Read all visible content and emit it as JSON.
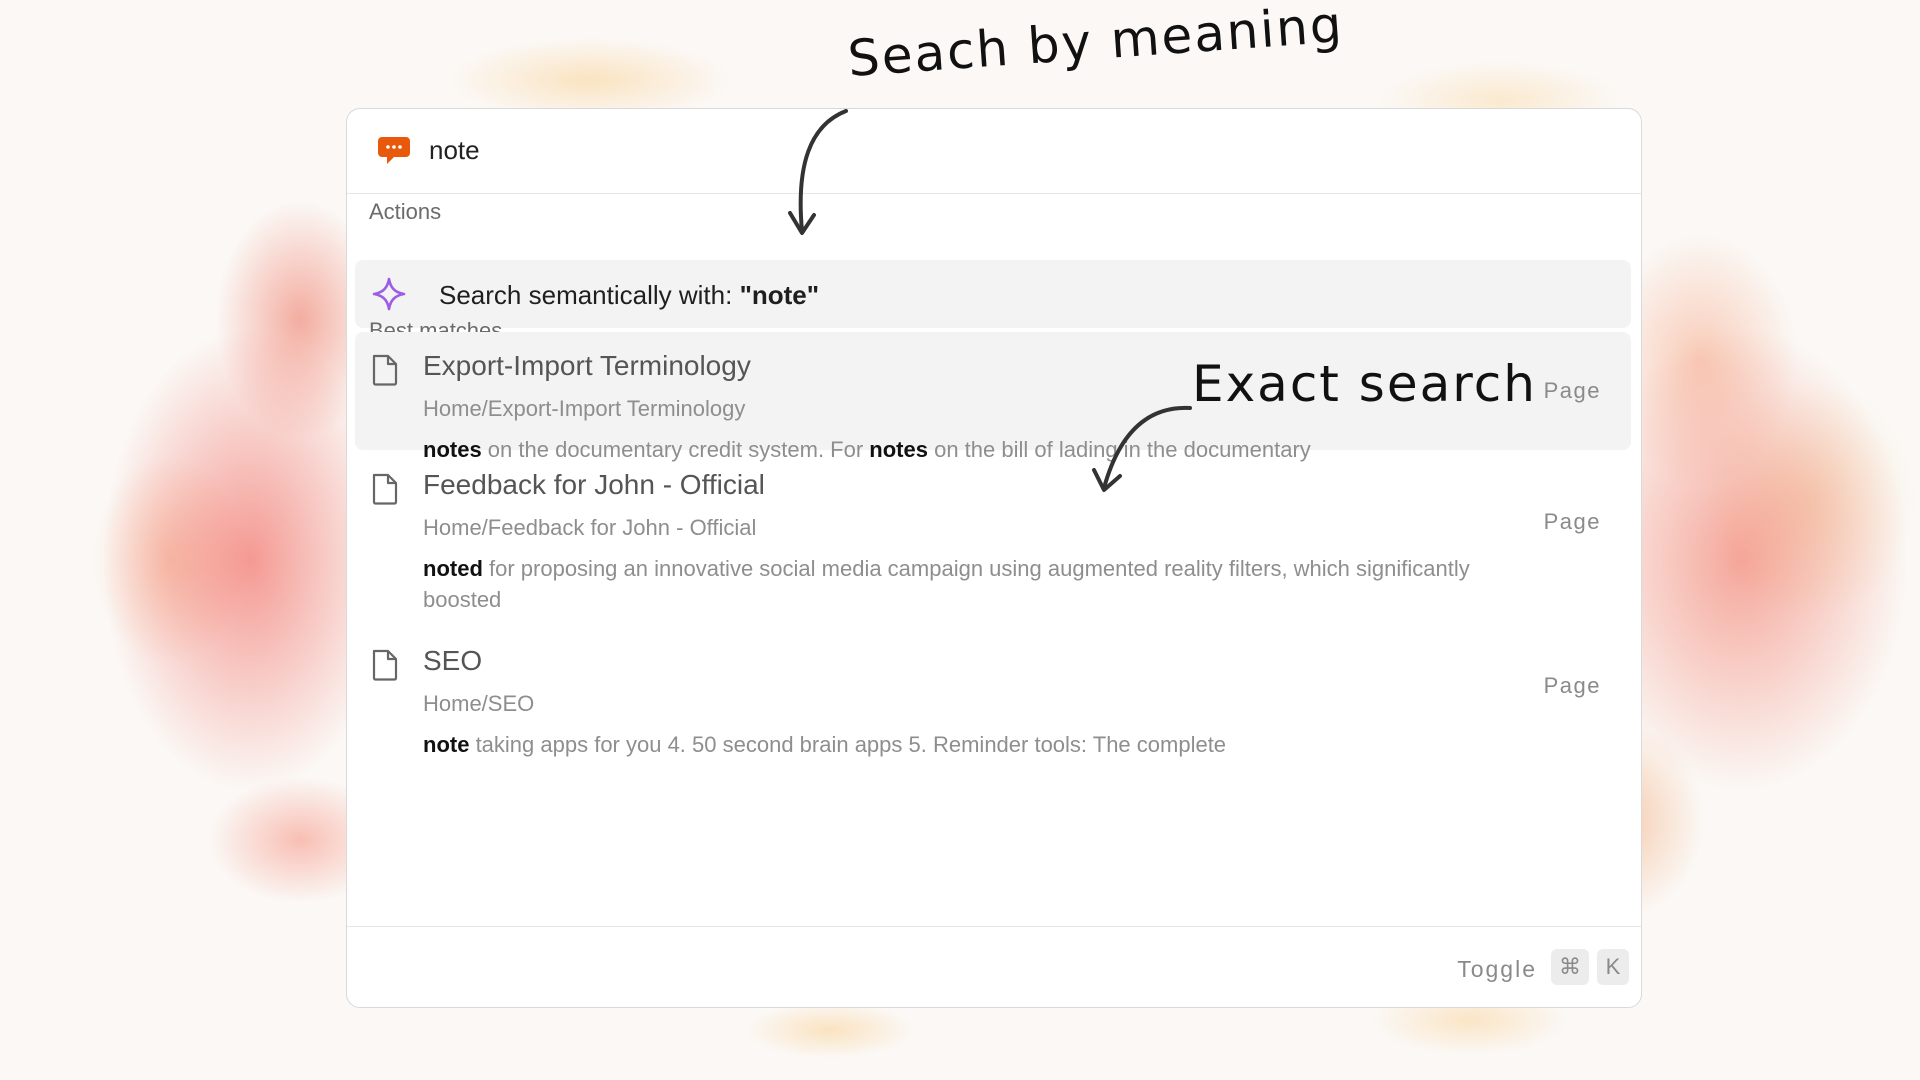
{
  "search": {
    "query": "note",
    "app_icon": "speech-bubble-icon",
    "app_icon_color": "#e8590c"
  },
  "actions": {
    "label": "Actions",
    "semantic_prefix": "Search semantically with: ",
    "semantic_query": "\"note\"",
    "icon": "sparkle-icon",
    "icon_color": "#9b5de5"
  },
  "best_matches": {
    "label": "Best matches",
    "results": [
      {
        "icon": "document-icon",
        "title": "Export-Import Terminology",
        "path": "Home/Export-Import Terminology",
        "snippet": [
          {
            "text": "notes",
            "highlight": true
          },
          {
            "text": " on the documentary credit system. For ",
            "highlight": false
          },
          {
            "text": "notes",
            "highlight": true
          },
          {
            "text": " on the bill of lading in the documentary",
            "highlight": false
          }
        ],
        "type": "Page"
      },
      {
        "icon": "document-icon",
        "title": "Feedback for John - Official",
        "path": "Home/Feedback for John - Official",
        "snippet": [
          {
            "text": "noted",
            "highlight": true
          },
          {
            "text": " for proposing an innovative social media campaign using augmented reality filters, which significantly boosted",
            "highlight": false
          }
        ],
        "type": "Page"
      },
      {
        "icon": "document-icon",
        "title": "SEO",
        "path": "Home/SEO",
        "snippet": [
          {
            "text": "note",
            "highlight": true
          },
          {
            "text": " taking apps for you 4. 50 second brain apps 5. Reminder tools: The complete",
            "highlight": false
          }
        ],
        "type": "Page"
      }
    ]
  },
  "footer": {
    "toggle_label": "Toggle",
    "keys": [
      "⌘",
      "K"
    ]
  },
  "annotations": {
    "semantic": "Seach by meaning",
    "exact": "Exact search"
  }
}
